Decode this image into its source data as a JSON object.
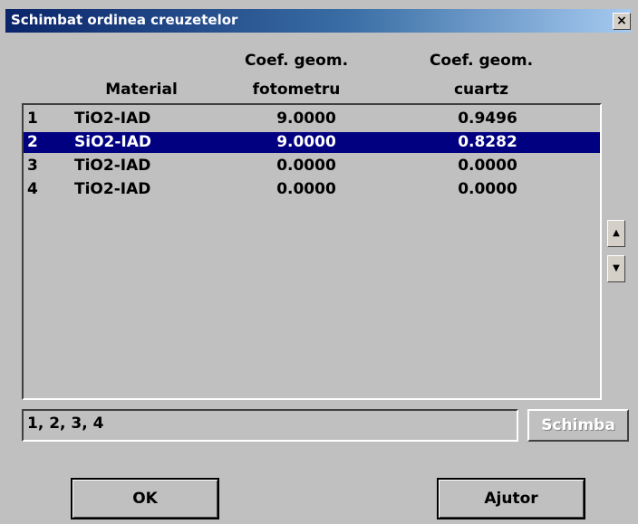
{
  "window": {
    "title": "Schimbat ordinea creuzetelor",
    "close_label": "×"
  },
  "headers": {
    "material": "Material",
    "fotometru_line1": "Coef. geom.",
    "fotometru_line2": "fotometru",
    "cuartz_line1": "Coef. geom.",
    "cuartz_line2": "cuartz"
  },
  "rows": [
    {
      "index": "1",
      "material": "TiO2-IAD",
      "fotometru": "9.0000",
      "cuartz": "0.9496",
      "selected": false
    },
    {
      "index": "2",
      "material": "SiO2-IAD",
      "fotometru": "9.0000",
      "cuartz": "0.8282",
      "selected": true
    },
    {
      "index": "3",
      "material": "TiO2-IAD",
      "fotometru": "0.0000",
      "cuartz": "0.0000",
      "selected": false
    },
    {
      "index": "4",
      "material": "TiO2-IAD",
      "fotometru": "0.0000",
      "cuartz": "0.0000",
      "selected": false
    }
  ],
  "spin": {
    "up_icon": "arrow-up-icon",
    "up_glyph": "▲",
    "down_icon": "arrow-down-icon",
    "down_glyph": "▼"
  },
  "order_field": {
    "value": "1, 2, 3, 4"
  },
  "buttons": {
    "schimba": "Schimba",
    "ok": "OK",
    "help": "Ajutor"
  },
  "colors": {
    "selection": "#000080",
    "titlebar": "#0a246a",
    "face": "#c0c0c0"
  }
}
